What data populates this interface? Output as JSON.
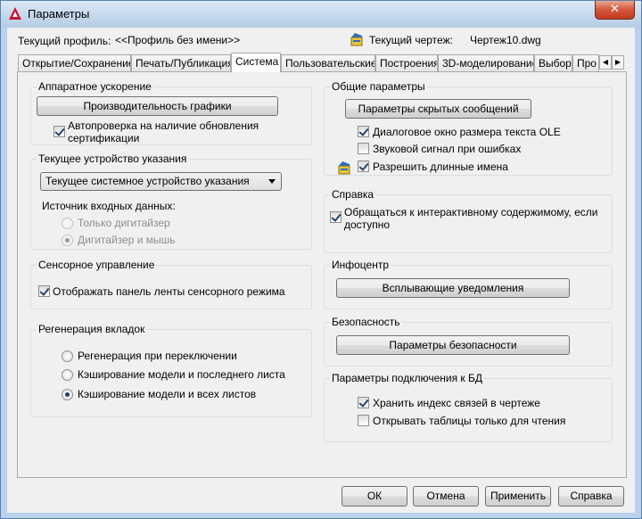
{
  "window": {
    "title": "Параметры",
    "close_glyph": "✕"
  },
  "profile": {
    "label": "Текущий профиль:",
    "value": "<<Профиль без имени>>"
  },
  "drawing": {
    "label": "Текущий чертеж:",
    "value": "Чертеж10.dwg",
    "icon": "drawing-file-icon"
  },
  "tabs": [
    {
      "label": "Открытие/Сохранение",
      "active": false
    },
    {
      "label": "Печать/Публикация",
      "active": false
    },
    {
      "label": "Система",
      "active": true
    },
    {
      "label": "Пользовательские",
      "active": false
    },
    {
      "label": "Построения",
      "active": false
    },
    {
      "label": "3D-моделирование",
      "active": false
    },
    {
      "label": "Выбор",
      "active": false
    },
    {
      "label": "Про",
      "active": false
    }
  ],
  "tab_scroll": {
    "left": "◀",
    "right": "▶"
  },
  "hardware": {
    "title": "Аппаратное ускорение",
    "button": "Производительность графики",
    "auto_check": {
      "label": "Автопроверка на наличие обновления сертификации",
      "line1": "Автопроверка на наличие обновления",
      "line2": "сертификации",
      "checked": true
    }
  },
  "pointing": {
    "title": "Текущее устройство указания",
    "dropdown_value": "Текущее системное устройство указания",
    "input_source_label": "Источник входных данных:",
    "options": [
      {
        "label": "Только дигитайзер",
        "checked": false,
        "disabled": true
      },
      {
        "label": "Дигитайзер и мышь",
        "checked": true,
        "disabled": true
      }
    ]
  },
  "touch": {
    "title": "Сенсорное управление",
    "checkbox": {
      "label": "Отображать панель ленты сенсорного режима",
      "checked": true
    }
  },
  "regen": {
    "title": "Регенерация вкладок",
    "options": [
      {
        "label": "Регенерация при переключении",
        "checked": false
      },
      {
        "label": "Кэширование модели и последнего листа",
        "checked": false
      },
      {
        "label": "Кэширование модели и всех листов",
        "checked": true
      }
    ]
  },
  "general": {
    "title": "Общие параметры",
    "button": "Параметры скрытых сообщений",
    "checkboxes": [
      {
        "label": "Диалоговое окно размера текста OLE",
        "checked": true
      },
      {
        "label": "Звуковой сигнал при ошибках",
        "checked": false
      },
      {
        "label": "Разрешить длинные имена",
        "checked": true
      }
    ]
  },
  "help": {
    "title": "Справка",
    "checkbox": {
      "label": "Обращаться к интерактивному содержимому, если доступно",
      "line1": "Обращаться к интерактивному содержимому, если",
      "line2": "доступно",
      "checked": true
    }
  },
  "infocenter": {
    "title": "Инфоцентр",
    "button": "Всплывающие уведомления"
  },
  "security": {
    "title": "Безопасность",
    "button": "Параметры безопасности"
  },
  "db": {
    "title": "Параметры подключения к БД",
    "checkboxes": [
      {
        "label": "Хранить индекс связей в чертеже",
        "checked": true
      },
      {
        "label": "Открывать таблицы только для чтения",
        "checked": false
      }
    ]
  },
  "footer": {
    "ok": "ОК",
    "cancel": "Отмена",
    "apply": "Применить",
    "help": "Справка"
  },
  "colors": {
    "title_bar": "#c3d7ec",
    "close_button": "#c9452a",
    "check_mark": "#22436f"
  }
}
